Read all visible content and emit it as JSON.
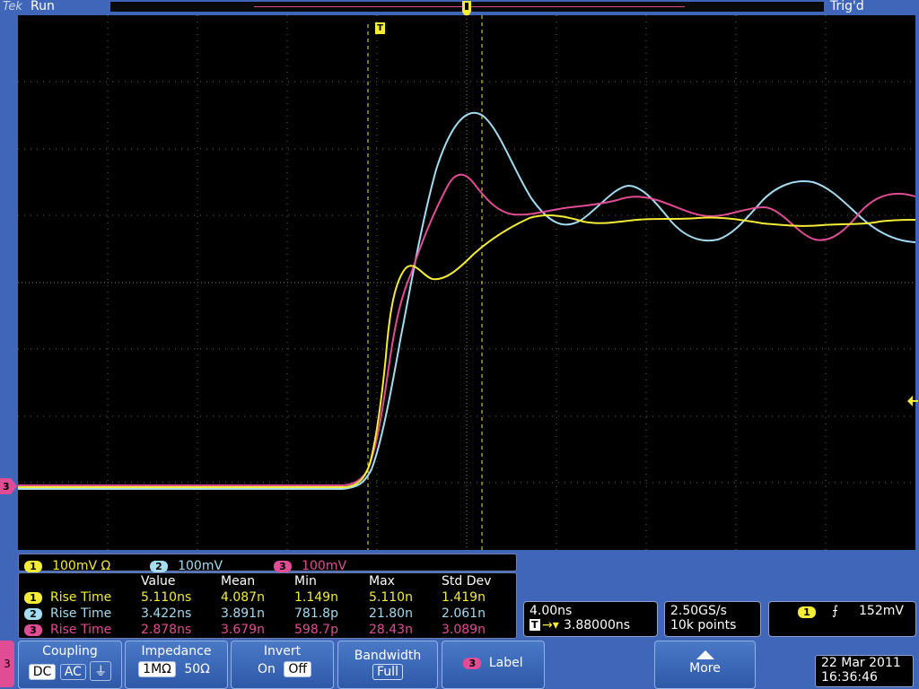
{
  "header": {
    "brand": "Tek",
    "run_state": "Run",
    "trigger_state": "Trig'd"
  },
  "trigger_marker": "T",
  "channel_scales": [
    {
      "num": "1",
      "label": "100mV Ω",
      "color": "#f4ec36"
    },
    {
      "num": "2",
      "label": "100mV",
      "color": "#a4dcf2"
    },
    {
      "num": "3",
      "label": "100mV",
      "color": "#e04d95"
    }
  ],
  "measurements": {
    "headers": [
      "Value",
      "Mean",
      "Min",
      "Max",
      "Std Dev"
    ],
    "rows": [
      {
        "ch": "1",
        "name": "Rise Time",
        "value": "5.110ns",
        "mean": "4.087n",
        "min": "1.149n",
        "max": "5.110n",
        "std": "1.419n"
      },
      {
        "ch": "2",
        "name": "Rise Time",
        "value": "3.422ns",
        "mean": "3.891n",
        "min": "781.8p",
        "max": "21.80n",
        "std": "2.061n"
      },
      {
        "ch": "3",
        "name": "Rise Time",
        "value": "2.878ns",
        "mean": "3.679n",
        "min": "598.7p",
        "max": "28.43n",
        "std": "3.089n"
      }
    ]
  },
  "horizontal": {
    "scale": "4.00ns",
    "delay": "3.88000ns"
  },
  "acquisition": {
    "sample_rate": "2.50GS/s",
    "record_length": "10k points"
  },
  "trigger": {
    "channel": "1",
    "slope_symbol": "⨍",
    "level": "152mV"
  },
  "menu": {
    "side_label": "3",
    "coupling": {
      "title": "Coupling",
      "options": [
        "DC",
        "AC",
        "⏚"
      ],
      "selected": "DC"
    },
    "impedance": {
      "title": "Impedance",
      "options": [
        "1MΩ",
        "50Ω"
      ],
      "selected": "1MΩ"
    },
    "invert": {
      "title": "Invert",
      "options": [
        "On",
        "Off"
      ],
      "selected": "Off"
    },
    "bandwidth": {
      "title": "Bandwidth",
      "value": "Full"
    },
    "label": {
      "chip": "3",
      "text": "Label"
    },
    "more": {
      "text": "More"
    }
  },
  "datetime": {
    "date": "22 Mar 2011",
    "time": "16:36:46"
  },
  "waveform_colors": {
    "ch1": "#f4ec36",
    "ch2": "#a4dcf2",
    "ch3": "#e04d95"
  }
}
